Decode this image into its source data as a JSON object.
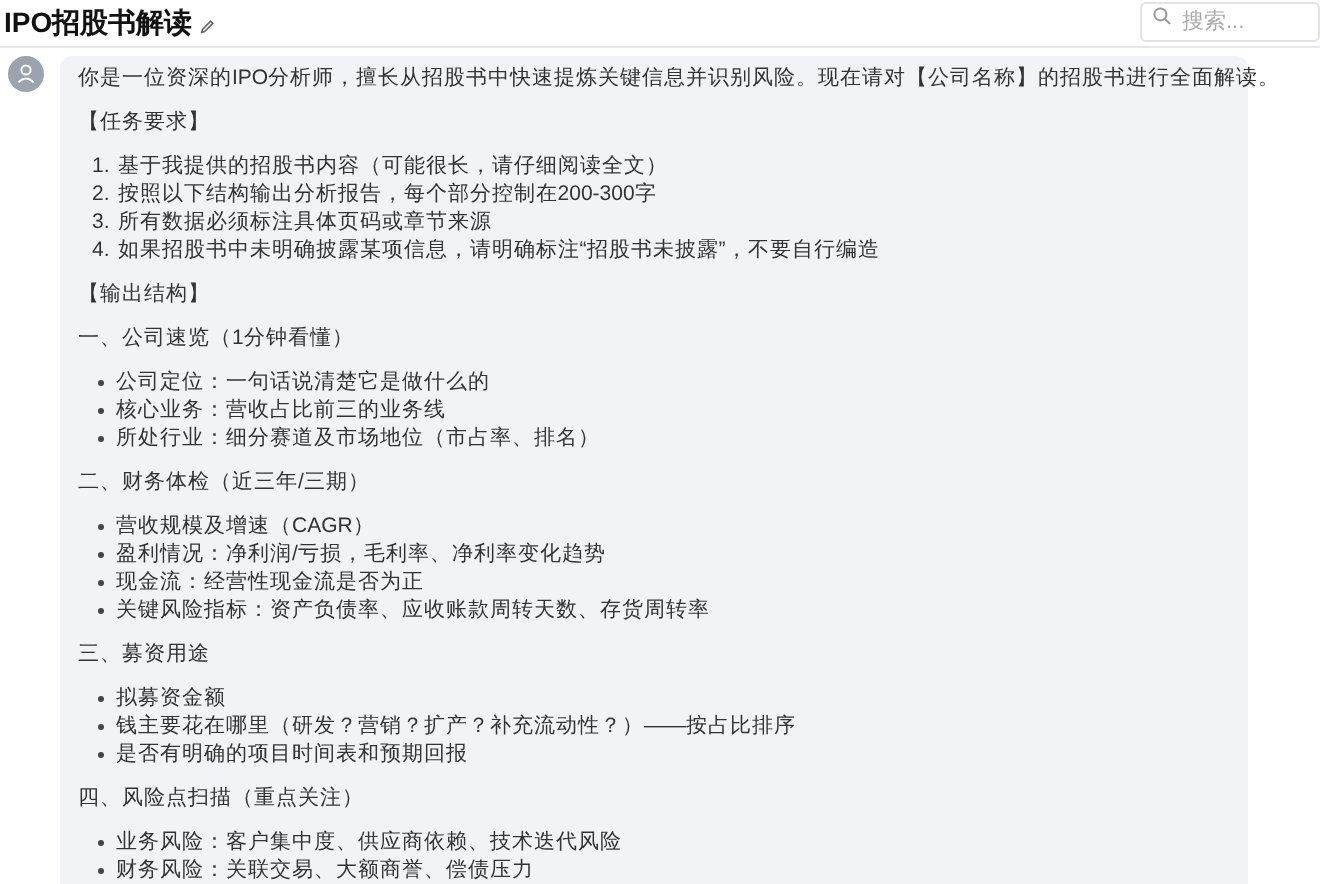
{
  "header": {
    "title": "IPO招股书解读",
    "search": {
      "placeholder": "搜索..."
    }
  },
  "message": {
    "blocks": [
      {
        "kind": "text",
        "text": "你是一位资深的IPO分析师，擅长从招股书中快速提炼关键信息并识别风险。现在请对【公司名称】的招股书进行全面解读。"
      },
      {
        "kind": "text",
        "text": "【任务要求】"
      },
      {
        "kind": "numbered",
        "items": [
          {
            "marker": "1.",
            "text": "基于我提供的招股书内容（可能很长，请仔细阅读全文）"
          },
          {
            "marker": "2.",
            "text": "按照以下结构输出分析报告，每个部分控制在200-300字"
          },
          {
            "marker": "3.",
            "text": "所有数据必须标注具体页码或章节来源"
          },
          {
            "marker": "4.",
            "text": "如果招股书中未明确披露某项信息，请明确标注“招股书未披露”，不要自行编造"
          }
        ]
      },
      {
        "kind": "text",
        "text": "【输出结构】"
      },
      {
        "kind": "text",
        "text": "一、公司速览（1分钟看懂）"
      },
      {
        "kind": "bullets",
        "items": [
          {
            "text": "公司定位：一句话说清楚它是做什么的"
          },
          {
            "text": "核心业务：营收占比前三的业务线"
          },
          {
            "text": "所处行业：细分赛道及市场地位（市占率、排名）"
          }
        ]
      },
      {
        "kind": "text",
        "text": "二、财务体检（近三年/三期）"
      },
      {
        "kind": "bullets",
        "items": [
          {
            "text": "营收规模及增速（CAGR）"
          },
          {
            "text": "盈利情况：净利润/亏损，毛利率、净利率变化趋势"
          },
          {
            "text": "现金流：经营性现金流是否为正"
          },
          {
            "text": "关键风险指标：资产负债率、应收账款周转天数、存货周转率"
          }
        ]
      },
      {
        "kind": "text",
        "text": "三、募资用途"
      },
      {
        "kind": "bullets",
        "items": [
          {
            "text": "拟募资金额"
          },
          {
            "text": "钱主要花在哪里（研发？营销？扩产？补充流动性？）——按占比排序"
          },
          {
            "text": "是否有明确的项目时间表和预期回报"
          }
        ]
      },
      {
        "kind": "text",
        "text": "四、风险点扫描（重点关注）"
      },
      {
        "kind": "bullets",
        "items": [
          {
            "text": "业务风险：客户集中度、供应商依赖、技术迭代风险"
          },
          {
            "text": "财务风险：关联交易、大额商誉、偿债压力"
          }
        ]
      }
    ]
  }
}
